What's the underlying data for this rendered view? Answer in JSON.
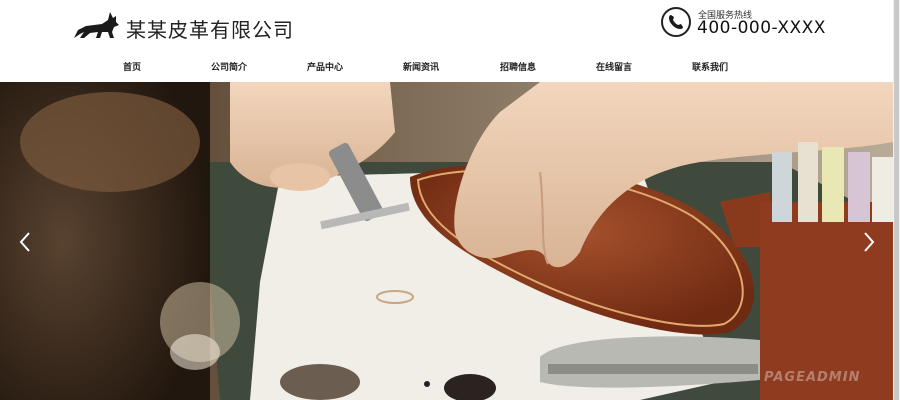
{
  "header": {
    "title": "某某皮革有限公司",
    "hotline_label": "全国服务热线",
    "hotline_number": "400-000-XXXX"
  },
  "nav": {
    "items": [
      {
        "label": "首页"
      },
      {
        "label": "公司简介"
      },
      {
        "label": "产品中心"
      },
      {
        "label": "新闻资讯"
      },
      {
        "label": "招聘信息"
      },
      {
        "label": "在线留言"
      },
      {
        "label": "联系我们"
      }
    ]
  },
  "banner": {
    "watermark": "PAGEADMIN",
    "icons": [
      "chevron-left-icon",
      "chevron-right-icon"
    ],
    "slide_count": 1,
    "active_slide": 1
  },
  "colors": {
    "text": "#222222",
    "leather": "#8a3a1c",
    "stitch": "#d9a36b",
    "background": "#ffffff"
  }
}
